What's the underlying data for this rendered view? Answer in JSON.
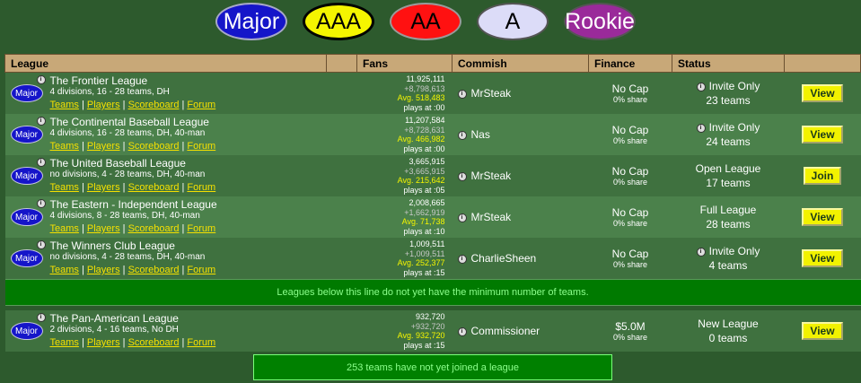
{
  "levels": [
    "Major",
    "AAA",
    "AA",
    "A",
    "Rookie"
  ],
  "headers": {
    "league": "League",
    "fans": "Fans",
    "commish": "Commish",
    "finance": "Finance",
    "status": "Status"
  },
  "links": {
    "teams": "Teams",
    "players": "Players",
    "scoreboard": "Scoreboard",
    "forum": "Forum",
    "separator": "|"
  },
  "info_glyph": "i",
  "leagues": [
    {
      "level": "Major",
      "name": "The Frontier League",
      "desc": "4 divisions, 16 - 28 teams, DH",
      "fans_total": "11,925,111",
      "fans_change": "+8,798,613",
      "fans_avg": "Avg. 518,483",
      "plays_at": "plays at :00",
      "commish": "MrSteak",
      "finance_cap": "No Cap",
      "finance_share": "0% share",
      "status_title": "Invite Only",
      "status_teams": "23 teams",
      "status_info": true,
      "action": "View"
    },
    {
      "level": "Major",
      "name": "The Continental Baseball League",
      "desc": "4 divisions, 16 - 28 teams, DH, 40-man",
      "fans_total": "11,207,584",
      "fans_change": "+8,728,631",
      "fans_avg": "Avg. 466,982",
      "plays_at": "plays at :00",
      "commish": "Nas",
      "finance_cap": "No Cap",
      "finance_share": "0% share",
      "status_title": "Invite Only",
      "status_teams": "24 teams",
      "status_info": true,
      "action": "View"
    },
    {
      "level": "Major",
      "name": "The United Baseball League",
      "desc": "no divisions, 4 - 28 teams, DH, 40-man",
      "fans_total": "3,665,915",
      "fans_change": "+3,665,915",
      "fans_avg": "Avg. 215,642",
      "plays_at": "plays at :05",
      "commish": "MrSteak",
      "finance_cap": "No Cap",
      "finance_share": "0% share",
      "status_title": "Open League",
      "status_teams": "17 teams",
      "status_info": false,
      "action": "Join"
    },
    {
      "level": "Major",
      "name": "The Eastern - Independent League",
      "desc": "4 divisions, 8 - 28 teams, DH, 40-man",
      "fans_total": "2,008,665",
      "fans_change": "+1,662,919",
      "fans_avg": "Avg. 71,738",
      "plays_at": "plays at :10",
      "commish": "MrSteak",
      "finance_cap": "No Cap",
      "finance_share": "0% share",
      "status_title": "Full League",
      "status_teams": "28 teams",
      "status_info": false,
      "action": "View"
    },
    {
      "level": "Major",
      "name": "The Winners Club League",
      "desc": "no divisions, 4 - 28 teams, DH, 40-man",
      "fans_total": "1,009,511",
      "fans_change": "+1,009,511",
      "fans_avg": "Avg. 252,377",
      "plays_at": "plays at :15",
      "commish": "CharlieSheen",
      "finance_cap": "No Cap",
      "finance_share": "0% share",
      "status_title": "Invite Only",
      "status_teams": "4 teams",
      "status_info": true,
      "action": "View"
    }
  ],
  "divider_text": "Leagues below this line do not yet have the minimum number of teams.",
  "pending_leagues": [
    {
      "level": "Major",
      "name": "The Pan-American League",
      "desc": "2 divisions, 4 - 16 teams, No DH",
      "fans_total": "932,720",
      "fans_change": "+932,720",
      "fans_avg": "Avg. 932,720",
      "plays_at": "plays at :15",
      "commish": "Commissioner",
      "finance_cap": "$5.0M",
      "finance_share": "0% share",
      "status_title": "New League",
      "status_teams": "0 teams",
      "status_info": false,
      "action": "View"
    }
  ],
  "footer": "253 teams have not yet joined a league"
}
